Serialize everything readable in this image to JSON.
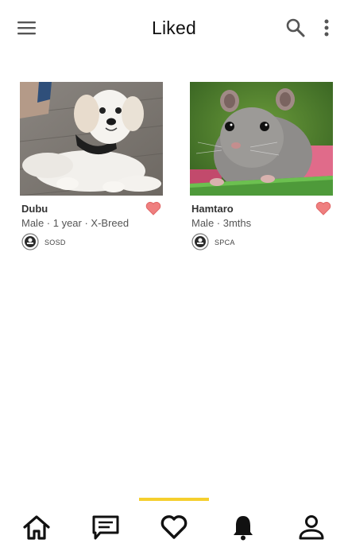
{
  "appbar": {
    "title": "Liked",
    "icons": [
      "menu-icon",
      "search-icon",
      "more-vert-icon"
    ]
  },
  "cards": [
    {
      "name": "Dubu",
      "meta": "Male · 1 year · X-Breed",
      "org": "SOSD",
      "liked": true,
      "photo": "white-dog-photo"
    },
    {
      "name": "Hamtaro",
      "meta": "Male · 3mths",
      "org": "SPCA",
      "liked": true,
      "photo": "hamster-photo"
    }
  ],
  "bottom_nav": {
    "active": "liked",
    "items": [
      "home-icon",
      "chat-icon",
      "heart-icon",
      "bell-icon",
      "person-icon"
    ]
  },
  "colors": {
    "accent": "#f5cf2e",
    "heart": "#ef7f7f",
    "text": "#111111"
  }
}
